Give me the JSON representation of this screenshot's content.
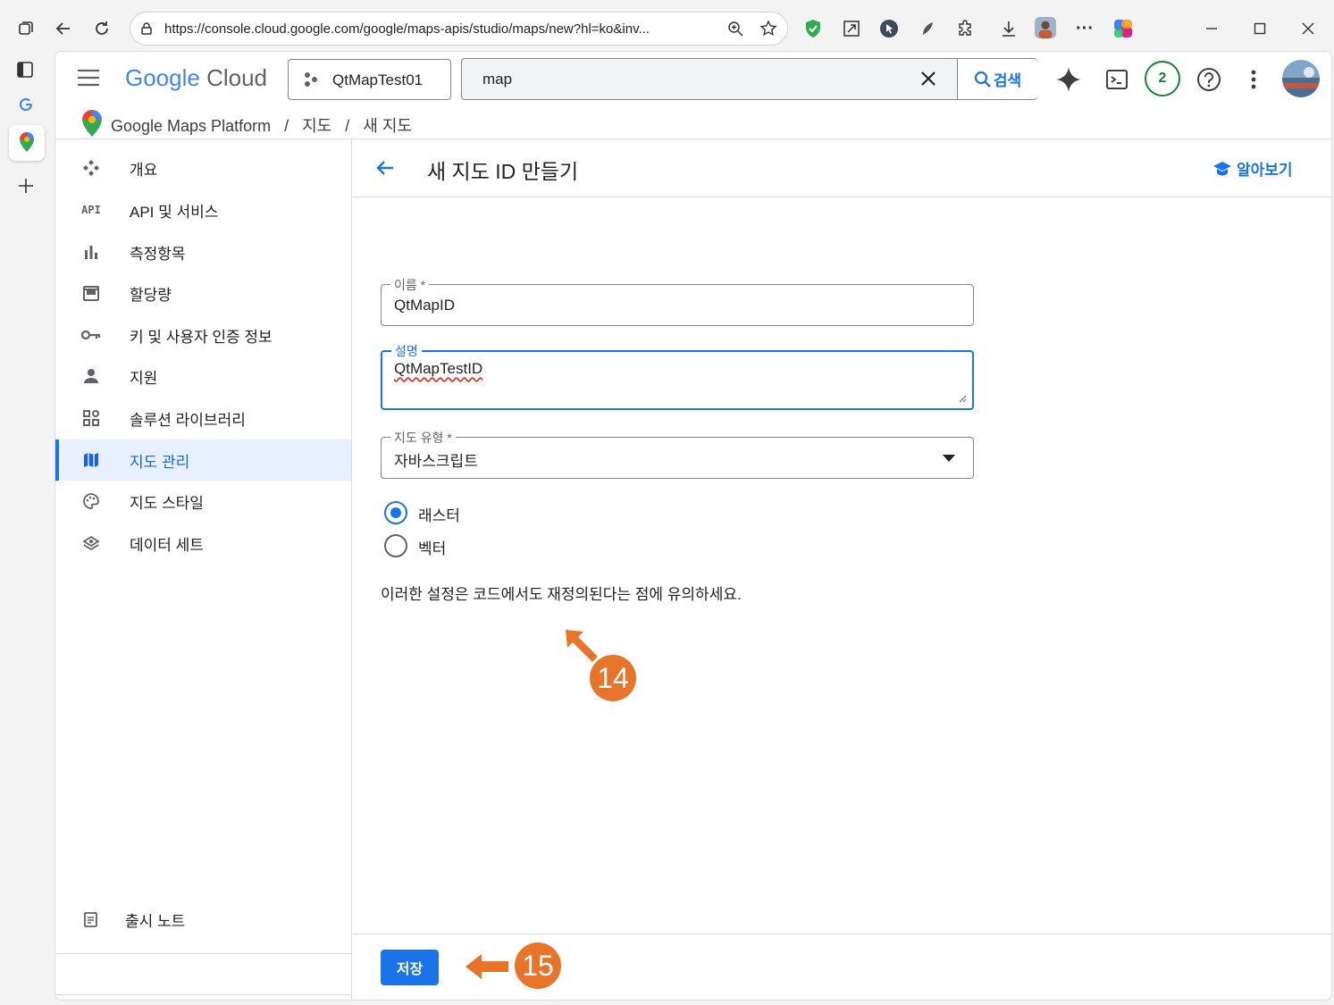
{
  "browser": {
    "url": "https://console.cloud.google.com/google/maps-apis/studio/maps/new?hl=ko&inv...",
    "icons": [
      "tab-actions-icon",
      "back-icon",
      "refresh-icon",
      "lock-icon",
      "zoom-icon",
      "star-icon",
      "shield-extension-icon",
      "expand-icon",
      "cursor-extension-icon",
      "pen-extension-icon",
      "puzzle-icon",
      "download-icon",
      "profile-icon",
      "more-icon",
      "copilot-icon",
      "minimize-icon",
      "maximize-icon",
      "close-icon"
    ]
  },
  "header": {
    "logo_google": "Google",
    "logo_cloud": "Cloud",
    "project_name": "QtMapTest01",
    "search_value": "map",
    "search_button": "검색",
    "notification_count": "2"
  },
  "breadcrumb": {
    "platform": "Google Maps Platform",
    "sep1": "/",
    "maps": "지도",
    "sep2": "/",
    "current": "새 지도"
  },
  "sidebar": {
    "items": [
      {
        "label": "개요",
        "icon": "overview-icon"
      },
      {
        "label": "API 및 서비스",
        "icon": "api-icon",
        "icon_text": "API"
      },
      {
        "label": "측정항목",
        "icon": "metrics-icon"
      },
      {
        "label": "할당량",
        "icon": "quota-icon"
      },
      {
        "label": "키 및 사용자 인증 정보",
        "icon": "key-icon"
      },
      {
        "label": "지원",
        "icon": "person-icon"
      },
      {
        "label": "솔루션 라이브러리",
        "icon": "library-icon"
      },
      {
        "label": "지도 관리",
        "icon": "map-icon",
        "active": true
      },
      {
        "label": "지도 스타일",
        "icon": "palette-icon"
      },
      {
        "label": "데이터 세트",
        "icon": "layers-icon"
      }
    ],
    "release_notes": "출시 노트",
    "collapse_label": "<I"
  },
  "main": {
    "title": "새 지도 ID 만들기",
    "learn_more": "알아보기",
    "name_label": "이름 *",
    "name_value": "QtMapID",
    "desc_label": "설명",
    "desc_value": "QtMapTestID",
    "type_label": "지도 유형 *",
    "type_value": "자바스크립트",
    "radio_raster": "래스터",
    "radio_vector": "벡터",
    "note": "이러한 설정은 코드에서도 재정의된다는 점에 유의하세요.",
    "save_button": "저장"
  },
  "callouts": {
    "step14": "14",
    "step15": "15"
  },
  "colors": {
    "accent": "#1a73e8",
    "callout": "#e8742a",
    "active_nav_bg": "#e8f0fe"
  }
}
